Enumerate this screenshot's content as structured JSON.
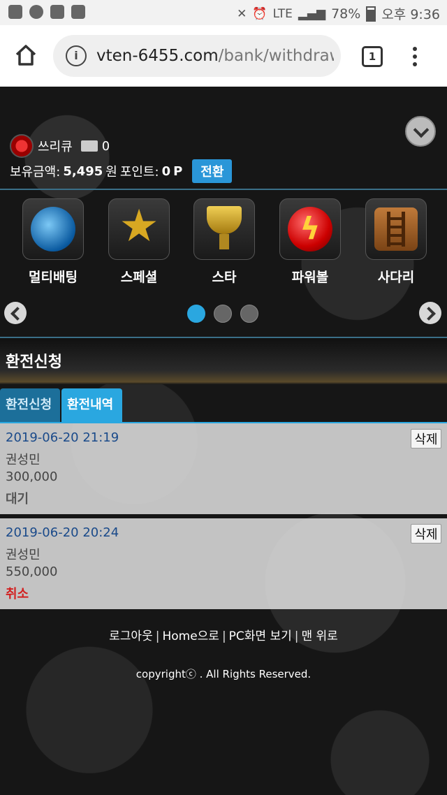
{
  "status_bar": {
    "battery": "78%",
    "time": "오후 9:36",
    "network": "LTE"
  },
  "browser": {
    "url_domain": "vten-6455.com",
    "url_path": "/bank/withdraw",
    "tab_count": "1"
  },
  "user": {
    "nickname": "쓰리큐",
    "message_count": "0",
    "balance_label": "보유금액:",
    "balance_value": "5,495",
    "balance_unit": "원",
    "points_label": "포인트:",
    "points_value": "0",
    "points_unit": "P",
    "convert_button": "전환"
  },
  "games": [
    {
      "label": "멀티배팅",
      "icon": "globe-icon"
    },
    {
      "label": "스페셜",
      "icon": "star-icon"
    },
    {
      "label": "스타",
      "icon": "trophy-icon"
    },
    {
      "label": "파워볼",
      "icon": "power-ball-icon"
    },
    {
      "label": "사다리",
      "icon": "ladder-icon"
    }
  ],
  "carousel": {
    "pages": 3,
    "active_page": 1
  },
  "section": {
    "title": "환전신청"
  },
  "tabs": [
    {
      "label": "환전신청",
      "active": false
    },
    {
      "label": "환전내역",
      "active": true
    }
  ],
  "records": [
    {
      "datetime": "2019-06-20 21:19",
      "name": "권성민",
      "amount": "300,000",
      "status": "대기",
      "delete_label": "삭제"
    },
    {
      "datetime": "2019-06-20 20:24",
      "name": "권성민",
      "amount": "550,000",
      "status": "취소",
      "delete_label": "삭제"
    }
  ],
  "footer": {
    "links": [
      "로그아웃",
      "Home으로",
      "PC화면 보기",
      "맨 위로"
    ],
    "copyright": "copyrightⓒ . All Rights Reserved."
  },
  "colors": {
    "accent": "#2aa7e0",
    "cancel": "#d21f1f",
    "date": "#1a4a8a"
  }
}
